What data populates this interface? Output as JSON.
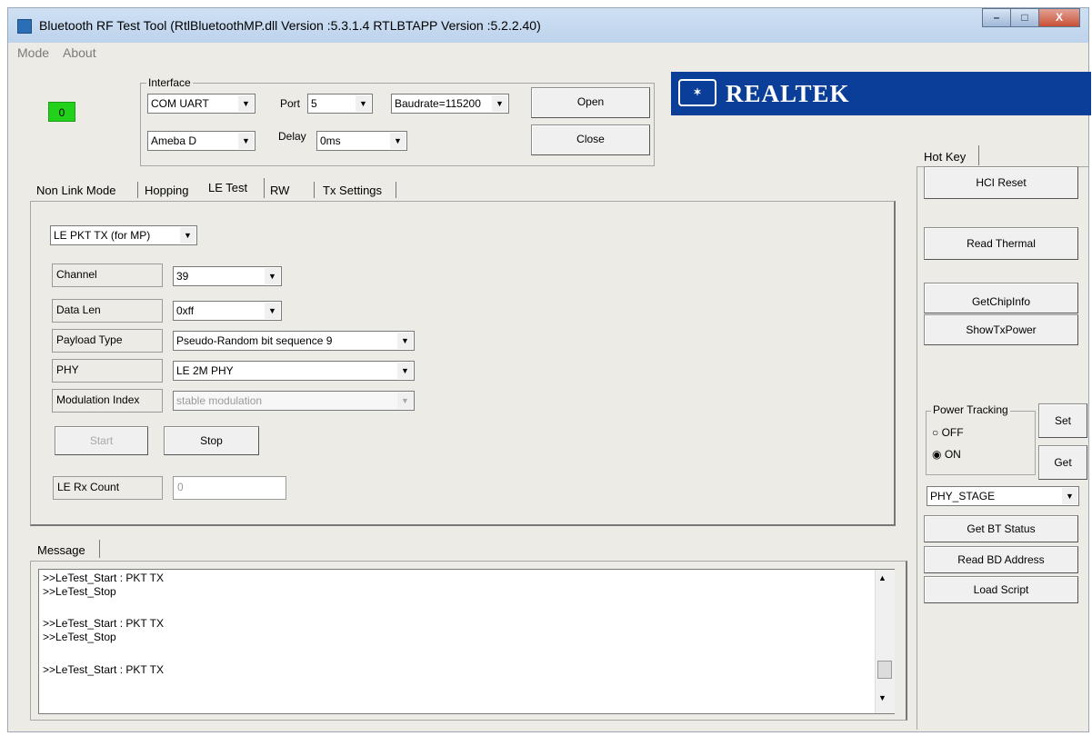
{
  "window": {
    "title": "Bluetooth RF Test Tool (RtlBluetoothMP.dll Version :5.3.1.4   RTLBTAPP Version :5.2.2.40)",
    "controls": {
      "minimize": "–",
      "maximize": "□",
      "close": "X"
    }
  },
  "menu": [
    "Mode",
    "About"
  ],
  "status_indicator": {
    "value": "0",
    "color": "#22d11a"
  },
  "interface": {
    "group_label": "Interface",
    "connection_type": "COM UART",
    "port_label": "Port",
    "port": "5",
    "baudrate": "Baudrate=115200",
    "device": "Ameba D",
    "delay_label": "Delay",
    "delay": "0ms",
    "open_label": "Open",
    "close_label": "Close"
  },
  "logo": {
    "text": "REALTEK",
    "bg_color": "#0a3e98"
  },
  "tabs": [
    "Non Link Mode",
    "Hopping",
    "LE Test",
    "RW",
    "Tx Settings"
  ],
  "le_test": {
    "mode": "LE PKT TX (for MP)",
    "fields": [
      {
        "label": "Channel",
        "value": "39"
      },
      {
        "label": "Data Len",
        "value": "0xff"
      },
      {
        "label": "Payload Type",
        "value": "Pseudo-Random bit sequence 9"
      },
      {
        "label": "PHY",
        "value": "LE 2M PHY"
      },
      {
        "label": "Modulation Index",
        "value": "stable modulation"
      }
    ],
    "start_label": "Start",
    "stop_label": "Stop",
    "rx_count_label": "LE Rx Count",
    "rx_count_value": "0"
  },
  "message": {
    "tab_label": "Message",
    "lines": [
      ">>LeTest_Start : PKT TX",
      ">>LeTest_Stop",
      "",
      ">>LeTest_Start : PKT TX",
      ">>LeTest_Stop",
      "",
      ">>LeTest_Start : PKT TX"
    ]
  },
  "hotkey": {
    "tab_label": "Hot Key",
    "hci_reset": "HCI Reset",
    "read_thermal": "Read Thermal",
    "get_chip_info": "GetChipInfo",
    "show_tx_power": "ShowTxPower",
    "power_tracking_label": "Power Tracking",
    "off_label": "OFF",
    "on_label": "ON",
    "set_label": "Set",
    "get_label": "Get",
    "stage": "PHY_STAGE",
    "get_bt_status": "Get BT Status",
    "read_bd_address": "Read BD Address",
    "load_script": "Load Script"
  }
}
